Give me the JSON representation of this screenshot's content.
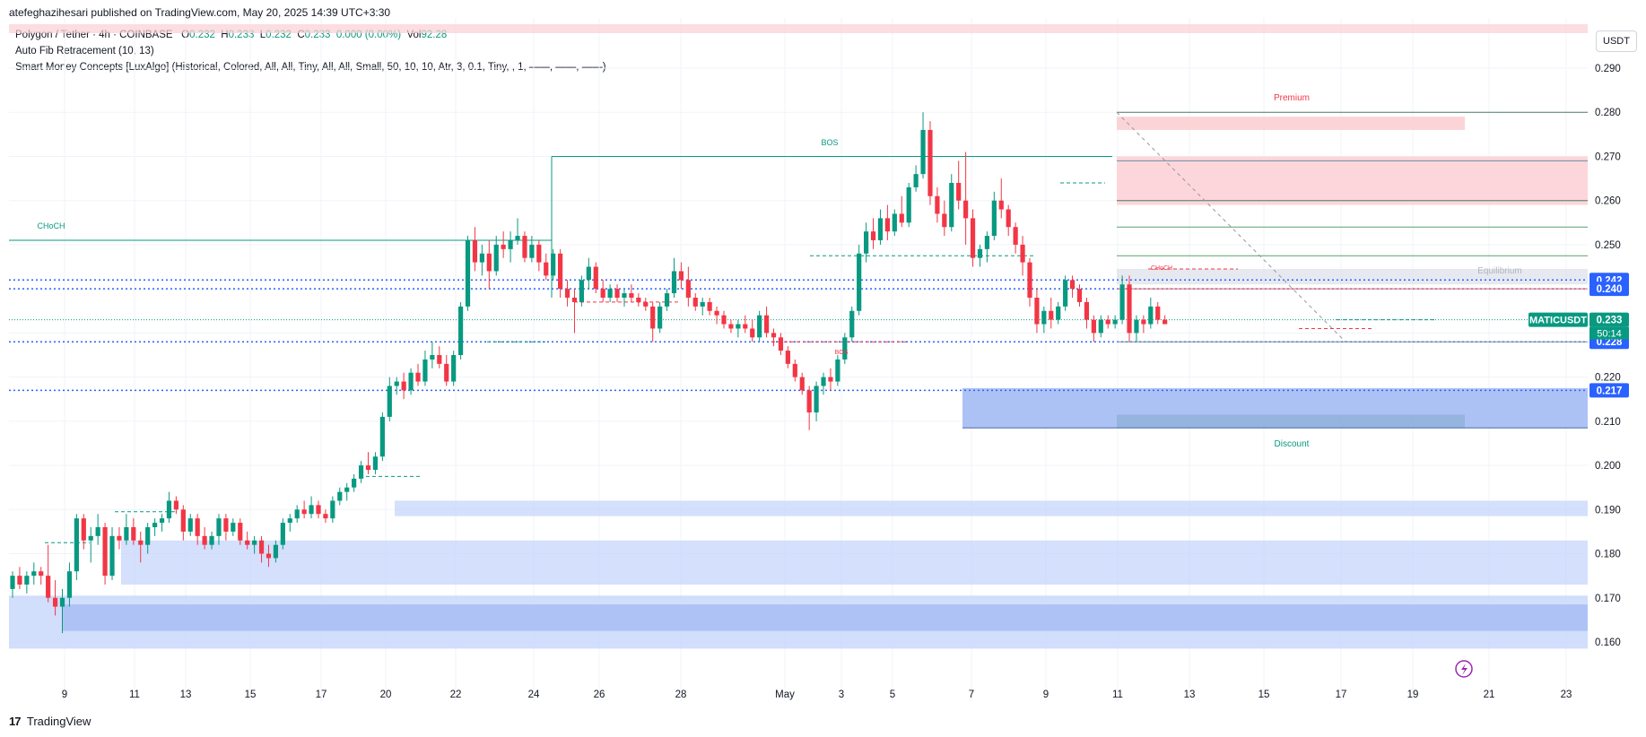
{
  "header": {
    "author": "atefeghazihesari",
    "publish_text": "published on TradingView.com, May 20, 2025 14:39 UTC+3:30"
  },
  "legend": {
    "symbol_line": "Polygon / Tether · 4h · COINBASE",
    "o_label": "O",
    "o": "0.232",
    "h_label": "H",
    "h": "0.233",
    "l_label": "L",
    "l": "0.232",
    "c_label": "C",
    "c": "0.233",
    "change": "0.000 (0.00%)",
    "vol_label": "Vol",
    "vol": "92.28",
    "indicator1": "Auto Fib Retracement (10, 13)",
    "indicator2": "Smart Money Concepts [LuxAlgo] (Historical, Colored, All, All, Tiny, All, All, Small, 50, 10, 10, Atr, 3, 0.1, Tiny, , 1, ——, ——, ——)"
  },
  "currency_button": "USDT",
  "footer": {
    "logo": "17",
    "brand": "TradingView"
  },
  "colors": {
    "bull": "#089981",
    "bear": "#f23645",
    "blue": "#2962ff",
    "zone_blue": "#c5d6fb",
    "zone_blue_dark": "#9fb7f2",
    "zone_red": "#fbcfd4",
    "grid": "#f0f3fa",
    "text": "#131722",
    "axis_text": "#131722"
  },
  "chart_data": {
    "type": "candlestick",
    "symbol": "MATICUSDT",
    "timeframe": "4h",
    "ylim": [
      0.155,
      0.297
    ],
    "yticks": [
      "0.160",
      "0.170",
      "0.180",
      "0.190",
      "0.200",
      "0.210",
      "0.220",
      "0.230",
      "0.240",
      "0.250",
      "0.260",
      "0.270",
      "0.280",
      "0.290"
    ],
    "xticks": [
      "9",
      "11",
      "13",
      "15",
      "17",
      "20",
      "22",
      "24",
      "26",
      "28",
      "May",
      "3",
      "5",
      "7",
      "9",
      "11",
      "13",
      "15",
      "17",
      "19",
      "21",
      "23"
    ],
    "price_labels": [
      {
        "text": "0.242",
        "value": 0.242,
        "color": "#2962ff"
      },
      {
        "text": "0.240",
        "value": 0.24,
        "color": "#2962ff"
      },
      {
        "text": "0.233",
        "value": 0.233,
        "color": "#089981"
      },
      {
        "text": "0.228",
        "value": 0.228,
        "color": "#2962ff"
      },
      {
        "text": "0.217",
        "value": 0.217,
        "color": "#2962ff"
      }
    ],
    "last_price_tag": {
      "symbol": "MATICUSDT",
      "price": "0.233",
      "countdown": "50:14"
    },
    "annotations": [
      {
        "text": "Premium",
        "color": "#f23645"
      },
      {
        "text": "Equilibrium",
        "color": "#b2b5be"
      },
      {
        "text": "Discount",
        "color": "#089981"
      },
      {
        "text": "BOS",
        "color": "#089981"
      },
      {
        "text": "CHoCH",
        "color": "#089981"
      },
      {
        "text": "CHoCH",
        "color": "#f23645"
      },
      {
        "text": "BOS",
        "color": "#f23645"
      }
    ],
    "candles": [
      [
        0.172,
        0.176,
        0.17,
        0.175
      ],
      [
        0.175,
        0.177,
        0.172,
        0.173
      ],
      [
        0.173,
        0.176,
        0.171,
        0.175
      ],
      [
        0.175,
        0.178,
        0.173,
        0.176
      ],
      [
        0.176,
        0.177,
        0.173,
        0.175
      ],
      [
        0.175,
        0.182,
        0.169,
        0.17
      ],
      [
        0.17,
        0.174,
        0.166,
        0.168
      ],
      [
        0.168,
        0.172,
        0.162,
        0.17
      ],
      [
        0.17,
        0.178,
        0.168,
        0.176
      ],
      [
        0.176,
        0.189,
        0.174,
        0.188
      ],
      [
        0.188,
        0.189,
        0.181,
        0.183
      ],
      [
        0.183,
        0.186,
        0.178,
        0.184
      ],
      [
        0.184,
        0.189,
        0.182,
        0.186
      ],
      [
        0.186,
        0.187,
        0.173,
        0.175
      ],
      [
        0.175,
        0.186,
        0.174,
        0.184
      ],
      [
        0.184,
        0.186,
        0.181,
        0.183
      ],
      [
        0.183,
        0.189,
        0.182,
        0.186
      ],
      [
        0.186,
        0.188,
        0.182,
        0.183
      ],
      [
        0.183,
        0.185,
        0.178,
        0.182
      ],
      [
        0.182,
        0.187,
        0.18,
        0.186
      ],
      [
        0.186,
        0.188,
        0.184,
        0.187
      ],
      [
        0.187,
        0.189,
        0.185,
        0.188
      ],
      [
        0.188,
        0.194,
        0.187,
        0.192
      ],
      [
        0.192,
        0.193,
        0.189,
        0.19
      ],
      [
        0.19,
        0.191,
        0.183,
        0.185
      ],
      [
        0.185,
        0.189,
        0.184,
        0.188
      ],
      [
        0.188,
        0.189,
        0.182,
        0.184
      ],
      [
        0.184,
        0.186,
        0.181,
        0.182
      ],
      [
        0.182,
        0.185,
        0.181,
        0.184
      ],
      [
        0.184,
        0.189,
        0.182,
        0.188
      ],
      [
        0.188,
        0.189,
        0.183,
        0.185
      ],
      [
        0.185,
        0.188,
        0.184,
        0.187
      ],
      [
        0.187,
        0.188,
        0.182,
        0.183
      ],
      [
        0.183,
        0.185,
        0.181,
        0.182
      ],
      [
        0.182,
        0.184,
        0.18,
        0.183
      ],
      [
        0.183,
        0.184,
        0.178,
        0.18
      ],
      [
        0.18,
        0.182,
        0.177,
        0.179
      ],
      [
        0.179,
        0.183,
        0.178,
        0.182
      ],
      [
        0.182,
        0.188,
        0.181,
        0.187
      ],
      [
        0.187,
        0.189,
        0.185,
        0.188
      ],
      [
        0.188,
        0.191,
        0.187,
        0.19
      ],
      [
        0.19,
        0.192,
        0.188,
        0.189
      ],
      [
        0.189,
        0.193,
        0.188,
        0.191
      ],
      [
        0.191,
        0.192,
        0.188,
        0.189
      ],
      [
        0.189,
        0.19,
        0.187,
        0.188
      ],
      [
        0.188,
        0.193,
        0.187,
        0.192
      ],
      [
        0.192,
        0.195,
        0.191,
        0.194
      ],
      [
        0.194,
        0.196,
        0.192,
        0.195
      ],
      [
        0.195,
        0.198,
        0.194,
        0.197
      ],
      [
        0.197,
        0.201,
        0.196,
        0.2
      ],
      [
        0.2,
        0.203,
        0.198,
        0.199
      ],
      [
        0.199,
        0.203,
        0.198,
        0.202
      ],
      [
        0.202,
        0.212,
        0.201,
        0.211
      ],
      [
        0.211,
        0.22,
        0.21,
        0.218
      ],
      [
        0.218,
        0.22,
        0.216,
        0.219
      ],
      [
        0.219,
        0.221,
        0.215,
        0.217
      ],
      [
        0.217,
        0.222,
        0.216,
        0.221
      ],
      [
        0.221,
        0.223,
        0.218,
        0.219
      ],
      [
        0.219,
        0.226,
        0.218,
        0.224
      ],
      [
        0.224,
        0.228,
        0.222,
        0.225
      ],
      [
        0.225,
        0.227,
        0.222,
        0.223
      ],
      [
        0.223,
        0.225,
        0.218,
        0.219
      ],
      [
        0.219,
        0.226,
        0.218,
        0.225
      ],
      [
        0.225,
        0.237,
        0.224,
        0.236
      ],
      [
        0.236,
        0.252,
        0.235,
        0.251
      ],
      [
        0.251,
        0.254,
        0.244,
        0.246
      ],
      [
        0.246,
        0.25,
        0.243,
        0.248
      ],
      [
        0.248,
        0.251,
        0.24,
        0.244
      ],
      [
        0.244,
        0.252,
        0.243,
        0.25
      ],
      [
        0.25,
        0.253,
        0.247,
        0.249
      ],
      [
        0.249,
        0.253,
        0.246,
        0.251
      ],
      [
        0.251,
        0.256,
        0.25,
        0.252
      ],
      [
        0.252,
        0.253,
        0.246,
        0.247
      ],
      [
        0.247,
        0.252,
        0.246,
        0.25
      ],
      [
        0.25,
        0.251,
        0.244,
        0.246
      ],
      [
        0.246,
        0.248,
        0.242,
        0.243
      ],
      [
        0.243,
        0.249,
        0.242,
        0.248
      ],
      [
        0.248,
        0.249,
        0.238,
        0.24
      ],
      [
        0.24,
        0.242,
        0.236,
        0.238
      ],
      [
        0.238,
        0.24,
        0.23,
        0.237
      ],
      [
        0.237,
        0.243,
        0.236,
        0.242
      ],
      [
        0.242,
        0.247,
        0.24,
        0.245
      ],
      [
        0.245,
        0.246,
        0.239,
        0.24
      ],
      [
        0.24,
        0.242,
        0.237,
        0.238
      ],
      [
        0.238,
        0.241,
        0.237,
        0.24
      ],
      [
        0.24,
        0.241,
        0.237,
        0.238
      ],
      [
        0.238,
        0.24,
        0.236,
        0.239
      ],
      [
        0.239,
        0.241,
        0.237,
        0.238
      ],
      [
        0.238,
        0.239,
        0.236,
        0.237
      ],
      [
        0.237,
        0.238,
        0.235,
        0.236
      ],
      [
        0.236,
        0.237,
        0.228,
        0.231
      ],
      [
        0.231,
        0.237,
        0.23,
        0.236
      ],
      [
        0.236,
        0.24,
        0.235,
        0.239
      ],
      [
        0.239,
        0.247,
        0.238,
        0.244
      ],
      [
        0.244,
        0.246,
        0.24,
        0.242
      ],
      [
        0.242,
        0.245,
        0.236,
        0.238
      ],
      [
        0.238,
        0.239,
        0.235,
        0.236
      ],
      [
        0.236,
        0.238,
        0.234,
        0.237
      ],
      [
        0.237,
        0.238,
        0.234,
        0.235
      ],
      [
        0.235,
        0.236,
        0.232,
        0.234
      ],
      [
        0.234,
        0.235,
        0.231,
        0.232
      ],
      [
        0.232,
        0.233,
        0.23,
        0.231
      ],
      [
        0.231,
        0.233,
        0.229,
        0.232
      ],
      [
        0.232,
        0.234,
        0.23,
        0.231
      ],
      [
        0.231,
        0.233,
        0.228,
        0.229
      ],
      [
        0.229,
        0.235,
        0.228,
        0.234
      ],
      [
        0.234,
        0.236,
        0.229,
        0.23
      ],
      [
        0.23,
        0.231,
        0.227,
        0.229
      ],
      [
        0.229,
        0.23,
        0.225,
        0.226
      ],
      [
        0.226,
        0.227,
        0.222,
        0.223
      ],
      [
        0.223,
        0.224,
        0.219,
        0.22
      ],
      [
        0.22,
        0.221,
        0.216,
        0.217
      ],
      [
        0.217,
        0.218,
        0.208,
        0.212
      ],
      [
        0.212,
        0.219,
        0.21,
        0.218
      ],
      [
        0.218,
        0.221,
        0.216,
        0.22
      ],
      [
        0.22,
        0.222,
        0.217,
        0.219
      ],
      [
        0.219,
        0.225,
        0.218,
        0.224
      ],
      [
        0.224,
        0.23,
        0.223,
        0.229
      ],
      [
        0.229,
        0.236,
        0.228,
        0.235
      ],
      [
        0.235,
        0.25,
        0.234,
        0.248
      ],
      [
        0.248,
        0.255,
        0.246,
        0.253
      ],
      [
        0.253,
        0.256,
        0.249,
        0.251
      ],
      [
        0.251,
        0.258,
        0.25,
        0.256
      ],
      [
        0.256,
        0.259,
        0.251,
        0.253
      ],
      [
        0.253,
        0.258,
        0.252,
        0.257
      ],
      [
        0.257,
        0.261,
        0.254,
        0.255
      ],
      [
        0.255,
        0.264,
        0.254,
        0.263
      ],
      [
        0.263,
        0.268,
        0.262,
        0.266
      ],
      [
        0.266,
        0.28,
        0.265,
        0.276
      ],
      [
        0.276,
        0.278,
        0.259,
        0.261
      ],
      [
        0.261,
        0.263,
        0.255,
        0.257
      ],
      [
        0.257,
        0.26,
        0.252,
        0.254
      ],
      [
        0.254,
        0.266,
        0.253,
        0.264
      ],
      [
        0.264,
        0.269,
        0.258,
        0.26
      ],
      [
        0.26,
        0.271,
        0.25,
        0.256
      ],
      [
        0.256,
        0.258,
        0.245,
        0.247
      ],
      [
        0.247,
        0.25,
        0.245,
        0.249
      ],
      [
        0.249,
        0.253,
        0.246,
        0.252
      ],
      [
        0.252,
        0.262,
        0.251,
        0.26
      ],
      [
        0.26,
        0.265,
        0.256,
        0.258
      ],
      [
        0.258,
        0.259,
        0.252,
        0.254
      ],
      [
        0.254,
        0.255,
        0.248,
        0.25
      ],
      [
        0.25,
        0.252,
        0.243,
        0.246
      ],
      [
        0.246,
        0.247,
        0.236,
        0.238
      ],
      [
        0.238,
        0.24,
        0.23,
        0.232
      ],
      [
        0.232,
        0.236,
        0.23,
        0.235
      ],
      [
        0.235,
        0.238,
        0.231,
        0.233
      ],
      [
        0.233,
        0.237,
        0.232,
        0.236
      ],
      [
        0.236,
        0.243,
        0.235,
        0.242
      ],
      [
        0.242,
        0.243,
        0.238,
        0.24
      ],
      [
        0.24,
        0.241,
        0.236,
        0.237
      ],
      [
        0.237,
        0.238,
        0.231,
        0.233
      ],
      [
        0.233,
        0.234,
        0.228,
        0.23
      ],
      [
        0.23,
        0.234,
        0.229,
        0.233
      ],
      [
        0.233,
        0.234,
        0.231,
        0.232
      ],
      [
        0.232,
        0.234,
        0.231,
        0.233
      ],
      [
        0.233,
        0.243,
        0.232,
        0.241
      ],
      [
        0.241,
        0.243,
        0.228,
        0.23
      ],
      [
        0.23,
        0.234,
        0.228,
        0.233
      ],
      [
        0.233,
        0.234,
        0.23,
        0.232
      ],
      [
        0.232,
        0.238,
        0.231,
        0.236
      ],
      [
        0.236,
        0.237,
        0.232,
        0.233
      ],
      [
        0.233,
        0.234,
        0.232,
        0.232
      ]
    ]
  }
}
